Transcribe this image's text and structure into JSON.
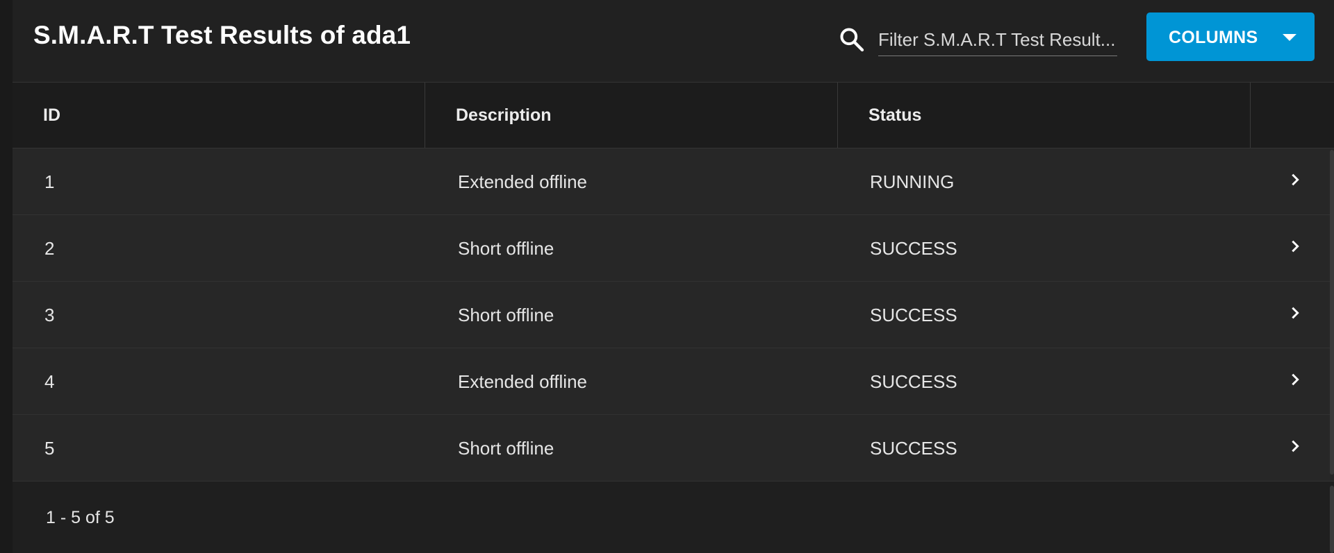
{
  "header": {
    "title": "S.M.A.R.T Test Results of ada1",
    "search": {
      "placeholder": "Filter S.M.A.R.T Test Result...",
      "value": ""
    },
    "columns_button": {
      "label": "COLUMNS",
      "icon": "caret-down-icon"
    }
  },
  "colors": {
    "accent": "#0095d5",
    "background": "#1f1f1f",
    "row": "#272727"
  },
  "table": {
    "headers": [
      "ID",
      "Description",
      "Status"
    ],
    "rows": [
      {
        "id": "1",
        "description": "Extended offline",
        "status": "RUNNING"
      },
      {
        "id": "2",
        "description": "Short offline",
        "status": "SUCCESS"
      },
      {
        "id": "3",
        "description": "Short offline",
        "status": "SUCCESS"
      },
      {
        "id": "4",
        "description": "Extended offline",
        "status": "SUCCESS"
      },
      {
        "id": "5",
        "description": "Short offline",
        "status": "SUCCESS"
      }
    ],
    "row_action_icon": "chevron-right-icon"
  },
  "footer": {
    "range": "1 - 5 of 5"
  }
}
